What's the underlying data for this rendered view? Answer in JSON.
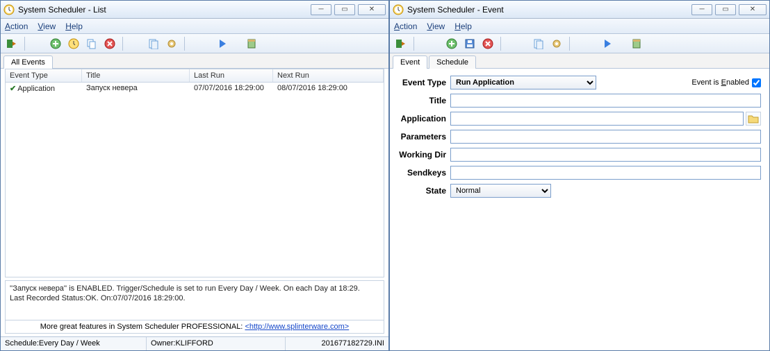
{
  "win1": {
    "title": "System Scheduler - List",
    "menus": {
      "action": "Action",
      "view": "View",
      "help": "Help"
    },
    "tab": "All Events",
    "columns": {
      "et": "Event Type",
      "ti": "Title",
      "lr": "Last Run",
      "nr": "Next Run"
    },
    "row": {
      "et": "Application",
      "ti": "Запуск невера",
      "lr": "07/07/2016 18:29:00",
      "nr": "08/07/2016 18:29:00"
    },
    "info1": "''Запуск невера'' is ENABLED. Trigger/Schedule is set to run Every Day / Week. On each Day at 18:29.",
    "info2": "Last Recorded Status:OK. On:07/07/2016 18:29:00.",
    "promo_prefix": "More great features in System Scheduler PROFESSIONAL: ",
    "promo_link": "<http://www.splinterware.com>",
    "status": {
      "s1": "Schedule:Every Day / Week",
      "s2": "Owner:KLIFFORD",
      "s3": "201677182729.INI"
    }
  },
  "win2": {
    "title": "System Scheduler - Event",
    "menus": {
      "action": "Action",
      "view": "View",
      "help": "Help"
    },
    "tabs": {
      "event": "Event",
      "schedule": "Schedule"
    },
    "labels": {
      "event_type": "Event Type",
      "title": "Title",
      "application": "Application",
      "parameters": "Parameters",
      "working_dir": "Working Dir",
      "sendkeys": "Sendkeys",
      "state": "State"
    },
    "event_type_value": "Run Application",
    "state_value": "Normal",
    "enabled_label": "Event is Enabled",
    "enabled_checked": true,
    "fields": {
      "title": "",
      "application": "",
      "parameters": "",
      "working_dir": "",
      "sendkeys": ""
    }
  }
}
